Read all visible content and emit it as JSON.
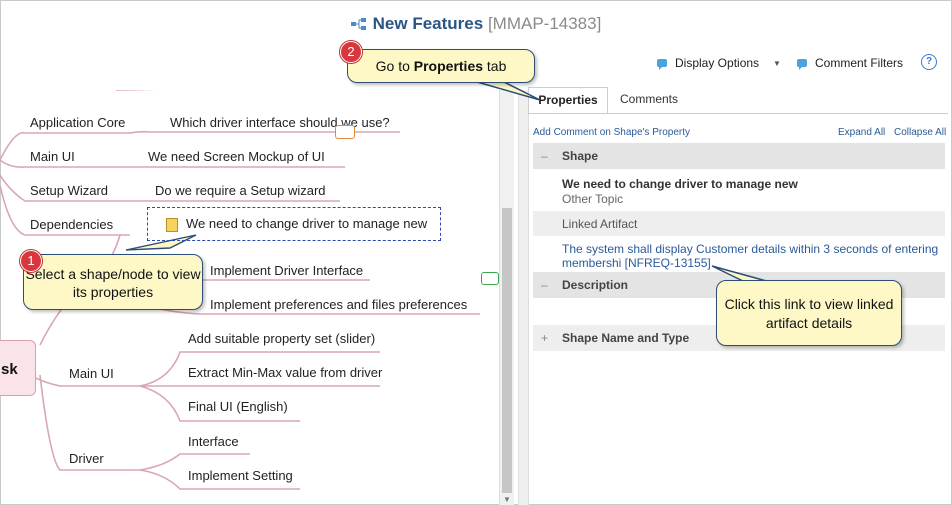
{
  "header": {
    "title": "New Features",
    "key": "[MMAP-14383]"
  },
  "toolbar": {
    "display_options": "Display Options",
    "comment_filters": "Comment Filters",
    "help": "?"
  },
  "mindmap": {
    "branch_upper": [
      "Application Core",
      "Main UI",
      "Setup Wizard",
      "Dependencies"
    ],
    "topics_upper": [
      "Which driver interface should we use?",
      "We need Screen Mockup of UI",
      "Do we require a Setup wizard",
      "We need to change driver to manage new"
    ],
    "topics_dependencies": [
      "Implement Driver Interface",
      "Implement preferences and files preferences"
    ],
    "root_label": "sk",
    "main_ui": "Main UI",
    "main_ui_children": [
      "Add suitable property set (slider)",
      "Extract Min-Max value from driver",
      "Final UI (English)"
    ],
    "driver": "Driver",
    "driver_children": [
      "Interface",
      "Implement Setting"
    ]
  },
  "panel": {
    "tabs": [
      "Properties",
      "Comments"
    ],
    "add_comment": "Add Comment on Shape's Property",
    "expand_all": "Expand All",
    "collapse_all": "Collapse All",
    "sections": {
      "shape": "Shape",
      "description": "Description",
      "shape_name_type": "Shape Name and Type"
    },
    "toggles": {
      "minus": "–",
      "plus": "+"
    },
    "shape_name": "We need to change driver to manage new",
    "shape_type": "Other Topic",
    "linked_artifact_label": "Linked Artifact",
    "linked_artifact_link": "The system shall display Customer details within 3 seconds of entering membershi [NFREQ-13155]"
  },
  "callouts": {
    "c1_badge": "1",
    "c1_text": "Select a shape/node to view its properties",
    "c2_badge": "2",
    "c2_prefix": "Go to ",
    "c2_bold": "Properties",
    "c2_suffix": " tab",
    "c3_text": "Click this link to view linked artifact details"
  },
  "colors": {
    "title": "#2a5686",
    "link": "#2a5a9a",
    "callout_bg": "#fdf8c6",
    "badge": "#d9363e",
    "branch": "#d9a6b3"
  }
}
